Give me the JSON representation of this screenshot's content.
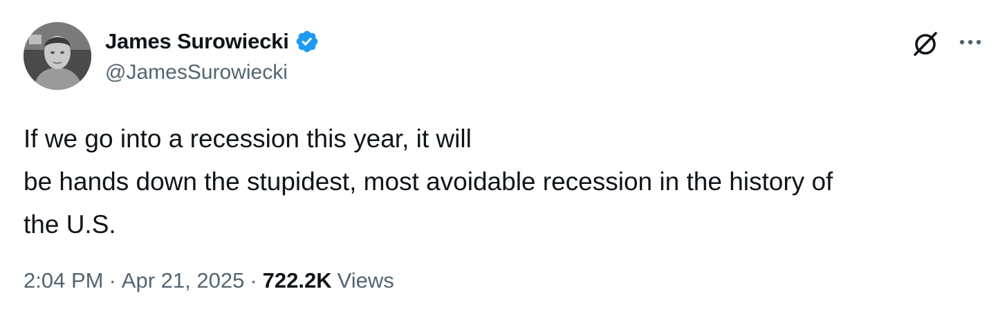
{
  "author": {
    "display_name": "James Surowiecki",
    "handle": "@JamesSurowiecki",
    "verified": true,
    "verified_color": "#1d9bf0"
  },
  "header_icons": {
    "grok": "grok-icon",
    "more": "more-options-icon"
  },
  "tweet": {
    "lines": [
      "If we go into a recession this year, it will",
      "be hands down the stupidest, most avoidable recession in the history of",
      "the U.S."
    ]
  },
  "meta": {
    "time": "2:04 PM",
    "separator": "·",
    "date": "Apr 21, 2025",
    "views_count": "722.2K",
    "views_label": "Views"
  },
  "colors": {
    "text_primary": "#0f1419",
    "text_secondary": "#536471",
    "background": "#ffffff"
  }
}
